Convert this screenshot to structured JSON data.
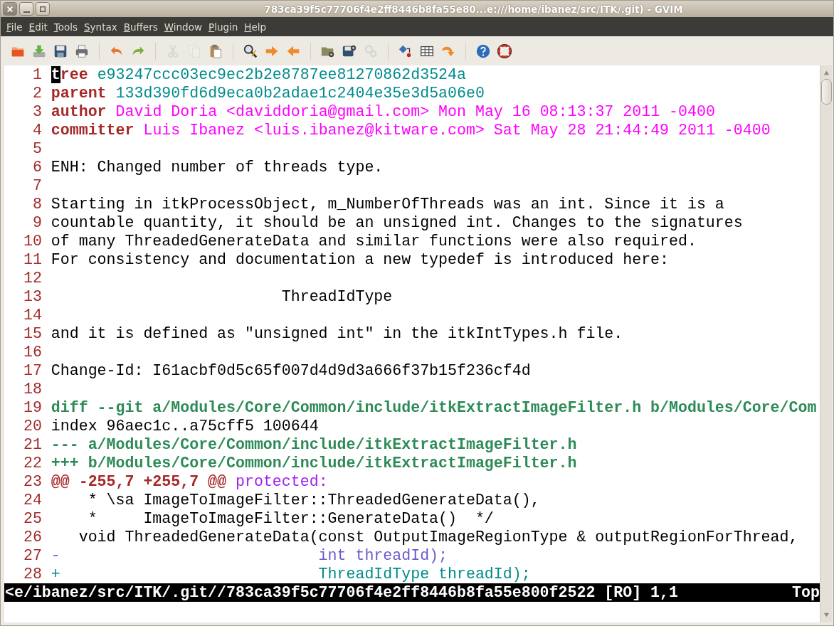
{
  "window": {
    "title": "783ca39f5c77706f4e2ff8446b8fa55e80...e:///home/ibanez/src/ITK/.git) - GVIM"
  },
  "menu": [
    "File",
    "Edit",
    "Tools",
    "Syntax",
    "Buffers",
    "Window",
    "Plugin",
    "Help"
  ],
  "toolbar": [
    {
      "kind": "open",
      "disabled": false
    },
    {
      "kind": "download",
      "disabled": false
    },
    {
      "kind": "save",
      "disabled": false
    },
    {
      "kind": "print",
      "disabled": false
    },
    {
      "kind": "separator"
    },
    {
      "kind": "undo",
      "disabled": false
    },
    {
      "kind": "redo",
      "disabled": false
    },
    {
      "kind": "separator"
    },
    {
      "kind": "cut",
      "disabled": true
    },
    {
      "kind": "copy",
      "disabled": true
    },
    {
      "kind": "paste",
      "disabled": false
    },
    {
      "kind": "separator"
    },
    {
      "kind": "find",
      "disabled": false
    },
    {
      "kind": "next",
      "disabled": false
    },
    {
      "kind": "prev",
      "disabled": false
    },
    {
      "kind": "separator"
    },
    {
      "kind": "folder-gear",
      "disabled": false
    },
    {
      "kind": "save-gear",
      "disabled": false
    },
    {
      "kind": "gears",
      "disabled": true
    },
    {
      "kind": "separator"
    },
    {
      "kind": "diamond",
      "disabled": false
    },
    {
      "kind": "table",
      "disabled": false
    },
    {
      "kind": "jump",
      "disabled": false
    },
    {
      "kind": "separator"
    },
    {
      "kind": "help",
      "disabled": false
    },
    {
      "kind": "lifebuoy",
      "disabled": false
    }
  ],
  "lines": [
    {
      "number": "1",
      "segments": [
        {
          "kind": "keyword",
          "text": "t",
          "cursor": true
        },
        {
          "kind": "keyword",
          "text": "ree"
        },
        {
          "kind": "hash",
          "text": "e93247ccc03ec9ec2b2e8787ee81270862d3524a"
        }
      ]
    },
    {
      "number": "2",
      "segments": [
        {
          "kind": "keyword",
          "text": "parent"
        },
        {
          "kind": "hash",
          "text": "133d390fd6d9eca0b2adae1c2404e35e3d5a06e0"
        }
      ]
    },
    {
      "number": "3",
      "segments": [
        {
          "kind": "keyword",
          "text": "author"
        },
        {
          "kind": "person",
          "text": "David Doria <daviddoria@gmail.com> Mon May 16 08:13:37 2011 -0400"
        }
      ]
    },
    {
      "number": "4",
      "segments": [
        {
          "kind": "keyword",
          "text": "committer"
        },
        {
          "kind": "person",
          "text": "Luis Ibanez <luis.ibanez@kitware.com> Sat May 28 21:44:49 2011 -0400"
        }
      ]
    },
    {
      "number": "5"
    },
    {
      "number": "6",
      "segments": [
        {
          "kind": "plain",
          "text": "ENH: Changed number of threads type."
        }
      ]
    },
    {
      "number": "7"
    },
    {
      "number": "8",
      "segments": [
        {
          "kind": "plain",
          "text": "Starting in itkProcessObject, m_NumberOfThreads was an int. Since it is a"
        }
      ]
    },
    {
      "number": "9",
      "segments": [
        {
          "kind": "plain",
          "text": "countable quantity, it should be an unsigned int. Changes to the signatures"
        }
      ]
    },
    {
      "number": "10",
      "segments": [
        {
          "kind": "plain",
          "text": "of many ThreadedGenerateData and similar functions were also required."
        }
      ]
    },
    {
      "number": "11",
      "segments": [
        {
          "kind": "plain",
          "text": "For consistency and documentation a new typedef is introduced here:"
        }
      ]
    },
    {
      "number": "12"
    },
    {
      "number": "13",
      "segments": [
        {
          "kind": "plain",
          "text": "                         ThreadIdType"
        }
      ]
    },
    {
      "number": "14"
    },
    {
      "number": "15",
      "segments": [
        {
          "kind": "plain",
          "text": "and it is defined as \"unsigned int\" in the itkIntTypes.h file."
        }
      ]
    },
    {
      "number": "16"
    },
    {
      "number": "17",
      "segments": [
        {
          "kind": "plain",
          "text": "Change-Id: I61acbf0d5c65f007d4d9d3a666f37b15f236cf4d"
        }
      ]
    },
    {
      "number": "18"
    },
    {
      "number": "19",
      "segments": [
        {
          "kind": "diff_header",
          "text": "diff --git a/Modules/Core/Common/include/itkExtractImageFilter.h b/Modules/Core/Com"
        }
      ]
    },
    {
      "number": "20",
      "segments": [
        {
          "kind": "plain",
          "text": "index 96aec1c..a75cff5 100644"
        }
      ]
    },
    {
      "number": "21",
      "segments": [
        {
          "kind": "diff_header",
          "text": "--- a/Modules/Core/Common/include/itkExtractImageFilter.h"
        }
      ]
    },
    {
      "number": "22",
      "segments": [
        {
          "kind": "diff_header",
          "text": "+++ b/Modules/Core/Common/include/itkExtractImageFilter.h"
        }
      ]
    },
    {
      "number": "23",
      "segments": [
        {
          "kind": "hunk",
          "text": "@@ -255,7 +255,7 @@"
        },
        {
          "kind": "section",
          "text": "protected:"
        }
      ]
    },
    {
      "number": "24",
      "segments": [
        {
          "kind": "plain",
          "text": "    * \\sa ImageToImageFilter::ThreadedGenerateData(),"
        }
      ]
    },
    {
      "number": "25",
      "segments": [
        {
          "kind": "plain",
          "text": "    *     ImageToImageFilter::GenerateData()  */"
        }
      ]
    },
    {
      "number": "26",
      "segments": [
        {
          "kind": "plain",
          "text": "   void ThreadedGenerateData(const OutputImageRegionType & outputRegionForThread,"
        }
      ]
    },
    {
      "number": "27",
      "segments": [
        {
          "kind": "removed",
          "text": "-                            int threadId);"
        }
      ]
    },
    {
      "number": "28",
      "segments": [
        {
          "kind": "added",
          "text": "+                            ThreadIdType threadId);"
        }
      ]
    }
  ],
  "status_bar": {
    "file": "<e/ibanez/src/ITK/.git//783ca39f5c77706f4e2ff8446b8fa55e800f2522 [RO] 1,1",
    "position": "Top"
  }
}
